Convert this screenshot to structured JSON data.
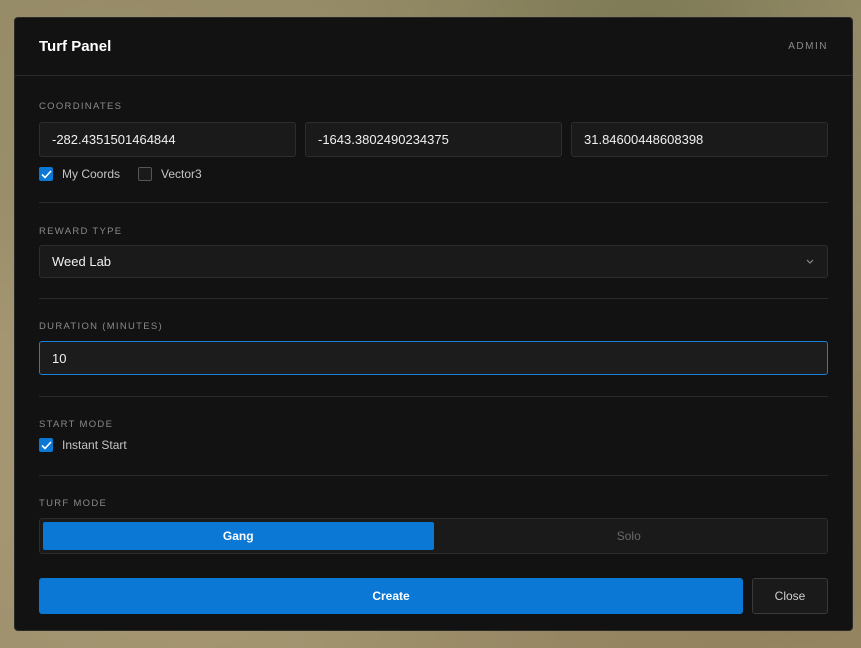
{
  "panel": {
    "title": "Turf Panel",
    "badge": "ADMIN"
  },
  "coordinates": {
    "label": "COORDINATES",
    "x": "-282.4351501464844",
    "y": "-1643.3802490234375",
    "z": "31.84600448608398",
    "options": [
      {
        "label": "My Coords",
        "checked": true
      },
      {
        "label": "Vector3",
        "checked": false
      }
    ]
  },
  "reward": {
    "label": "REWARD TYPE",
    "selected": "Weed Lab"
  },
  "duration": {
    "label": "DURATION (MINUTES)",
    "value": "10"
  },
  "start_mode": {
    "label": "START MODE",
    "option_label": "Instant Start",
    "checked": true
  },
  "turf_mode": {
    "label": "TURF MODE",
    "options": [
      "Gang",
      "Solo"
    ],
    "selected": "Gang"
  },
  "actions": {
    "create_label": "Create",
    "close_label": "Close"
  },
  "colors": {
    "accent": "#0a78d4",
    "panel_bg": "#121212"
  }
}
